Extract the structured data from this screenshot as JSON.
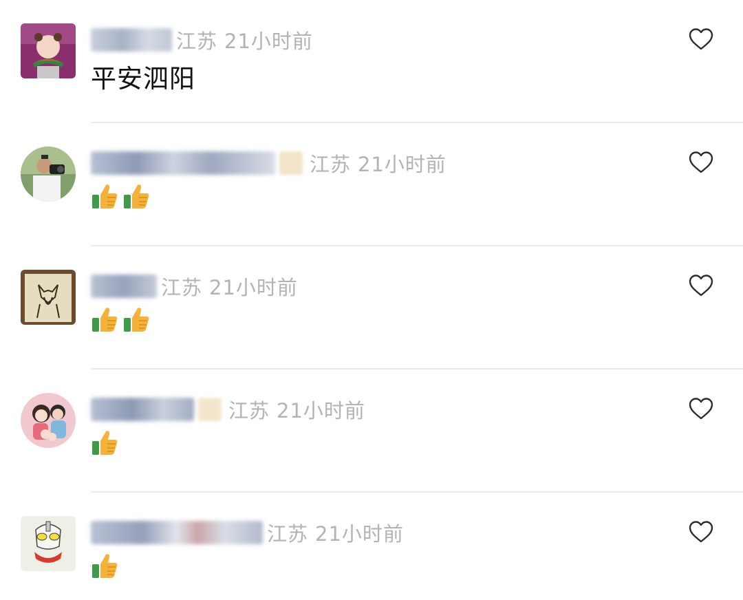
{
  "comments": [
    {
      "avatar": "avatar-girl-watermelon-icon",
      "location": "江苏",
      "time": "21小时前",
      "text": "平安泗阳",
      "thumbs": 0
    },
    {
      "avatar": "avatar-man-camera-icon",
      "location": "江苏",
      "time": "21小时前",
      "text": "",
      "thumbs": 2
    },
    {
      "avatar": "avatar-dog-drawing-icon",
      "location": "江苏",
      "time": "21小时前",
      "text": "",
      "thumbs": 2
    },
    {
      "avatar": "avatar-cartoon-family-icon",
      "location": "江苏",
      "time": "21小时前",
      "text": "",
      "thumbs": 1
    },
    {
      "avatar": "avatar-ultraman-icon",
      "location": "江苏",
      "time": "21小时前",
      "text": "",
      "thumbs": 1
    }
  ],
  "colors": {
    "meta_text": "#b3b3b3",
    "content_text": "#111111",
    "divider": "#ececec",
    "heart_outline": "#2b2b2b"
  }
}
